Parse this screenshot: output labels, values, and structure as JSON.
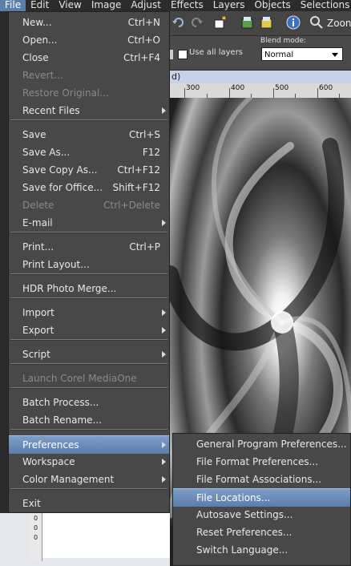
{
  "menubar": {
    "items": [
      "File",
      "Edit",
      "View",
      "Image",
      "Adjust",
      "Effects",
      "Layers",
      "Objects",
      "Selections"
    ]
  },
  "toolbar": {
    "zoom_label": "Zoon"
  },
  "options": {
    "use_all_layers": "Use all layers",
    "blend_mode_label": "Blend mode:",
    "blend_mode_value": "Normal"
  },
  "document": {
    "tab_fragment": "d)",
    "ruler_marks": [
      "300",
      "400",
      "500",
      "600"
    ],
    "vruler_marks": [
      "0",
      "0",
      "0"
    ]
  },
  "file_menu": {
    "items": [
      {
        "label": "New...",
        "shortcut": "Ctrl+N",
        "disabled": false,
        "submenu": false
      },
      {
        "label": "Open...",
        "shortcut": "Ctrl+O",
        "disabled": false,
        "submenu": false
      },
      {
        "label": "Close",
        "shortcut": "Ctrl+F4",
        "disabled": false,
        "submenu": false
      },
      {
        "label": "Revert...",
        "shortcut": "",
        "disabled": true,
        "submenu": false
      },
      {
        "label": "Restore Original...",
        "shortcut": "",
        "disabled": true,
        "submenu": false
      },
      {
        "label": "Recent Files",
        "shortcut": "",
        "disabled": false,
        "submenu": true
      },
      {
        "label": "Save",
        "shortcut": "Ctrl+S",
        "disabled": false,
        "submenu": false
      },
      {
        "label": "Save As...",
        "shortcut": "F12",
        "disabled": false,
        "submenu": false
      },
      {
        "label": "Save Copy As...",
        "shortcut": "Ctrl+F12",
        "disabled": false,
        "submenu": false
      },
      {
        "label": "Save for Office...",
        "shortcut": "Shift+F12",
        "disabled": false,
        "submenu": false
      },
      {
        "label": "Delete",
        "shortcut": "Ctrl+Delete",
        "disabled": true,
        "submenu": false
      },
      {
        "label": "E-mail",
        "shortcut": "",
        "disabled": false,
        "submenu": true
      },
      {
        "label": "Print...",
        "shortcut": "Ctrl+P",
        "disabled": false,
        "submenu": false
      },
      {
        "label": "Print Layout...",
        "shortcut": "",
        "disabled": false,
        "submenu": false
      },
      {
        "label": "HDR Photo Merge...",
        "shortcut": "",
        "disabled": false,
        "submenu": false
      },
      {
        "label": "Import",
        "shortcut": "",
        "disabled": false,
        "submenu": true
      },
      {
        "label": "Export",
        "shortcut": "",
        "disabled": false,
        "submenu": true
      },
      {
        "label": "Script",
        "shortcut": "",
        "disabled": false,
        "submenu": true
      },
      {
        "label": "Launch Corel MediaOne",
        "shortcut": "",
        "disabled": true,
        "submenu": false
      },
      {
        "label": "Batch Process...",
        "shortcut": "",
        "disabled": false,
        "submenu": false
      },
      {
        "label": "Batch Rename...",
        "shortcut": "",
        "disabled": false,
        "submenu": false
      },
      {
        "label": "Preferences",
        "shortcut": "",
        "disabled": false,
        "submenu": true,
        "selected": true
      },
      {
        "label": "Workspace",
        "shortcut": "",
        "disabled": false,
        "submenu": true
      },
      {
        "label": "Color Management",
        "shortcut": "",
        "disabled": false,
        "submenu": true
      },
      {
        "label": "Exit",
        "shortcut": "",
        "disabled": false,
        "submenu": false
      }
    ]
  },
  "preferences_submenu": {
    "items": [
      {
        "label": "General Program Preferences..."
      },
      {
        "label": "File Format Preferences..."
      },
      {
        "label": "File Format Associations..."
      },
      {
        "label": "File Locations...",
        "selected": true
      },
      {
        "label": "Autosave Settings..."
      },
      {
        "label": "Reset Preferences..."
      },
      {
        "label": "Switch Language..."
      }
    ]
  },
  "colors": {
    "menu_bg": "#484848",
    "highlight": "#6d8fbd",
    "disabled_text": "#8a8a8a"
  }
}
